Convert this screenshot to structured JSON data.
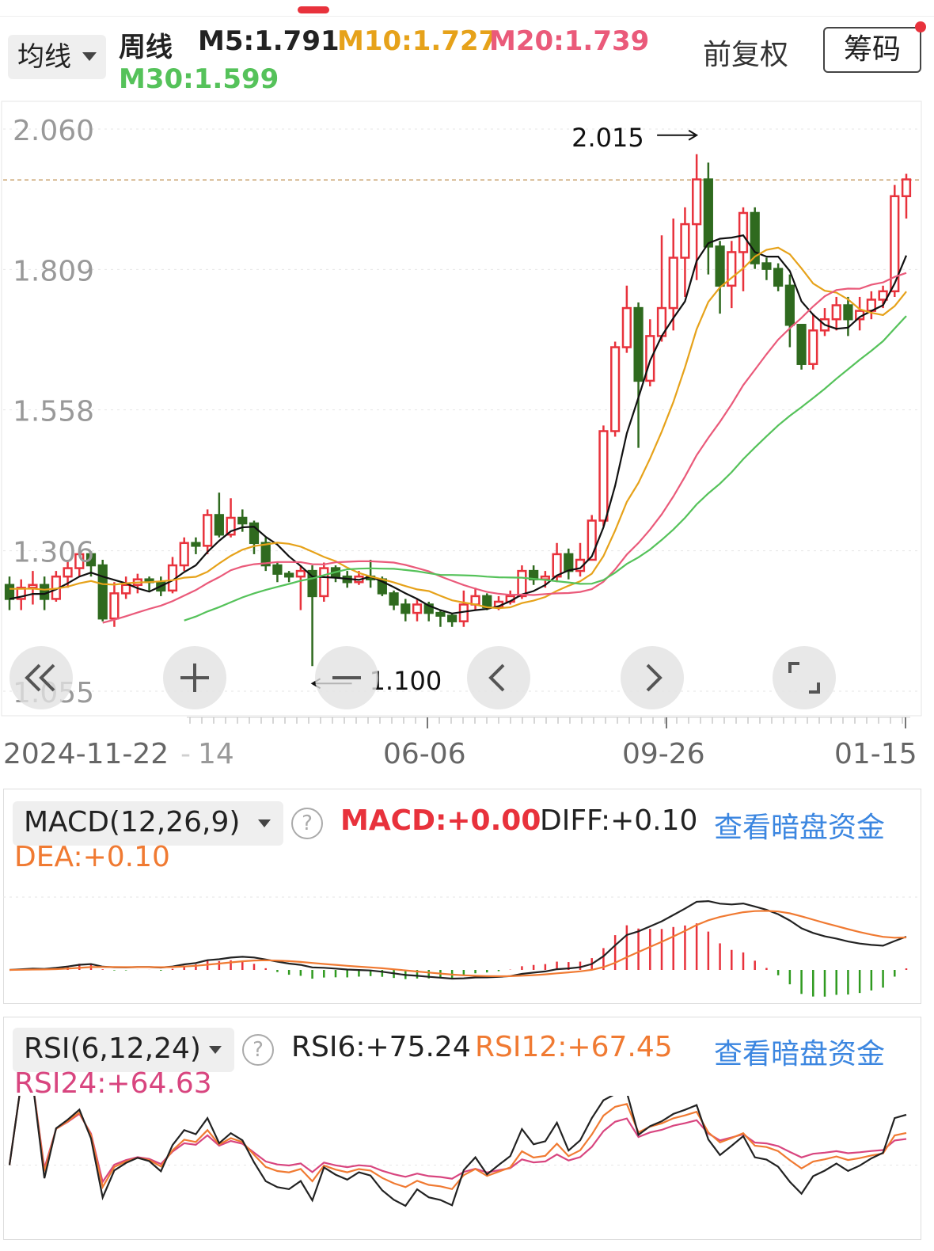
{
  "header": {
    "ma_select_label": "均线",
    "period": "周线",
    "ma": [
      {
        "label": "M5:1.791",
        "color": "#222222"
      },
      {
        "label": "M10:1.727",
        "color": "#e6a21a"
      },
      {
        "label": "M20:1.739",
        "color": "#ea5a7a"
      },
      {
        "label": "M30:1.599",
        "color": "#55c25a"
      }
    ],
    "adjust_label": "前复权",
    "chip_label": "筹码"
  },
  "main_chart": {
    "y_ticks": [
      "2.060",
      "1.809",
      "1.558",
      "1.306",
      "1.055"
    ],
    "x_ticks": [
      "2024-11-22",
      "14",
      "06-06",
      "09-26",
      "01-15"
    ],
    "high_annotation": "2.015",
    "low_annotation": "1.100",
    "current_price_line": 1.969,
    "colors": {
      "up": "#e8323c",
      "down": "#2f6a1f",
      "ma5": "#111111",
      "ma10": "#e6a21a",
      "ma20": "#ea5a7a",
      "ma30": "#55c25a"
    },
    "controls": [
      {
        "name": "scroll-start-button",
        "icon": "double-chevron-left-icon"
      },
      {
        "name": "zoom-in-button",
        "icon": "plus-icon"
      },
      {
        "name": "zoom-out-button",
        "icon": "minus-icon"
      },
      {
        "name": "previous-button",
        "icon": "chevron-left-icon"
      },
      {
        "name": "next-button",
        "icon": "chevron-right-icon"
      },
      {
        "name": "fullscreen-button",
        "icon": "fullscreen-icon"
      }
    ]
  },
  "macd_panel": {
    "select_label": "MACD(12,26,9)",
    "macd": "MACD:+0.00",
    "diff": "DIFF:+0.10",
    "dea": "DEA:+0.10",
    "link": "查看暗盘资金"
  },
  "rsi_panel": {
    "select_label": "RSI(6,12,24)",
    "rsi6": "RSI6:+75.24",
    "rsi12": "RSI12:+67.45",
    "rsi24": "RSI24:+64.63",
    "link": "查看暗盘资金"
  },
  "chart_data": {
    "type": "candlestick",
    "period": "weekly",
    "ylim": [
      1.055,
      2.06
    ],
    "candles": [
      [
        1.245,
        1.22,
        1.26,
        1.2
      ],
      [
        1.22,
        1.24,
        1.255,
        1.2
      ],
      [
        1.24,
        1.245,
        1.27,
        1.21
      ],
      [
        1.245,
        1.22,
        1.26,
        1.2
      ],
      [
        1.22,
        1.26,
        1.27,
        1.215
      ],
      [
        1.26,
        1.275,
        1.29,
        1.24
      ],
      [
        1.275,
        1.3,
        1.31,
        1.26
      ],
      [
        1.3,
        1.28,
        1.305,
        1.26
      ],
      [
        1.28,
        1.185,
        1.29,
        1.18
      ],
      [
        1.185,
        1.23,
        1.25,
        1.17
      ],
      [
        1.23,
        1.245,
        1.26,
        1.22
      ],
      [
        1.245,
        1.255,
        1.265,
        1.23
      ],
      [
        1.255,
        1.25,
        1.26,
        1.235
      ],
      [
        1.25,
        1.235,
        1.26,
        1.225
      ],
      [
        1.235,
        1.28,
        1.295,
        1.23
      ],
      [
        1.28,
        1.32,
        1.33,
        1.27
      ],
      [
        1.32,
        1.315,
        1.33,
        1.3
      ],
      [
        1.315,
        1.37,
        1.38,
        1.3
      ],
      [
        1.37,
        1.335,
        1.41,
        1.33
      ],
      [
        1.335,
        1.365,
        1.4,
        1.33
      ],
      [
        1.365,
        1.355,
        1.38,
        1.34
      ],
      [
        1.355,
        1.32,
        1.36,
        1.3
      ],
      [
        1.32,
        1.28,
        1.33,
        1.27
      ],
      [
        1.28,
        1.265,
        1.285,
        1.25
      ],
      [
        1.265,
        1.26,
        1.27,
        1.25
      ],
      [
        1.26,
        1.27,
        1.28,
        1.2
      ],
      [
        1.27,
        1.225,
        1.28,
        1.1
      ],
      [
        1.225,
        1.275,
        1.285,
        1.215
      ],
      [
        1.275,
        1.26,
        1.28,
        1.25
      ],
      [
        1.26,
        1.25,
        1.27,
        1.24
      ],
      [
        1.25,
        1.26,
        1.27,
        1.245
      ],
      [
        1.26,
        1.255,
        1.29,
        1.24
      ],
      [
        1.255,
        1.23,
        1.26,
        1.225
      ],
      [
        1.23,
        1.21,
        1.235,
        1.2
      ],
      [
        1.21,
        1.195,
        1.22,
        1.18
      ],
      [
        1.195,
        1.21,
        1.22,
        1.18
      ],
      [
        1.21,
        1.195,
        1.215,
        1.18
      ],
      [
        1.195,
        1.19,
        1.2,
        1.17
      ],
      [
        1.19,
        1.18,
        1.195,
        1.17
      ],
      [
        1.18,
        1.21,
        1.235,
        1.17
      ],
      [
        1.21,
        1.225,
        1.24,
        1.2
      ],
      [
        1.225,
        1.205,
        1.23,
        1.2
      ],
      [
        1.205,
        1.215,
        1.225,
        1.2
      ],
      [
        1.215,
        1.225,
        1.235,
        1.21
      ],
      [
        1.225,
        1.27,
        1.28,
        1.22
      ],
      [
        1.27,
        1.255,
        1.28,
        1.245
      ],
      [
        1.255,
        1.26,
        1.27,
        1.24
      ],
      [
        1.26,
        1.3,
        1.32,
        1.25
      ],
      [
        1.3,
        1.27,
        1.31,
        1.255
      ],
      [
        1.27,
        1.29,
        1.32,
        1.26
      ],
      [
        1.29,
        1.36,
        1.37,
        1.29
      ],
      [
        1.36,
        1.52,
        1.53,
        1.35
      ],
      [
        1.52,
        1.67,
        1.68,
        1.51
      ],
      [
        1.67,
        1.74,
        1.78,
        1.66
      ],
      [
        1.74,
        1.61,
        1.75,
        1.49
      ],
      [
        1.61,
        1.69,
        1.72,
        1.6
      ],
      [
        1.69,
        1.74,
        1.87,
        1.68
      ],
      [
        1.74,
        1.83,
        1.9,
        1.7
      ],
      [
        1.83,
        1.89,
        1.92,
        1.76
      ],
      [
        1.89,
        1.97,
        2.015,
        1.79
      ],
      [
        1.97,
        1.85,
        2.0,
        1.8
      ],
      [
        1.85,
        1.78,
        1.86,
        1.73
      ],
      [
        1.78,
        1.84,
        1.86,
        1.74
      ],
      [
        1.84,
        1.91,
        1.92,
        1.77
      ],
      [
        1.91,
        1.82,
        1.92,
        1.81
      ],
      [
        1.82,
        1.81,
        1.83,
        1.79
      ],
      [
        1.81,
        1.78,
        1.82,
        1.77
      ],
      [
        1.78,
        1.71,
        1.8,
        1.67
      ],
      [
        1.71,
        1.64,
        1.71,
        1.63
      ],
      [
        1.64,
        1.7,
        1.73,
        1.63
      ],
      [
        1.7,
        1.72,
        1.74,
        1.69
      ],
      [
        1.72,
        1.745,
        1.76,
        1.7
      ],
      [
        1.745,
        1.72,
        1.76,
        1.69
      ],
      [
        1.72,
        1.735,
        1.76,
        1.7
      ],
      [
        1.735,
        1.755,
        1.77,
        1.72
      ],
      [
        1.755,
        1.77,
        1.78,
        1.74
      ],
      [
        1.77,
        1.94,
        1.96,
        1.76
      ],
      [
        1.94,
        1.97,
        1.98,
        1.9
      ]
    ],
    "ma5_endpoints": [
      1.22,
      1.791
    ],
    "ma10_endpoints": [
      1.24,
      1.727
    ],
    "ma20_endpoints": [
      1.12,
      1.739
    ],
    "ma30_endpoints": [
      1.1,
      1.599
    ]
  }
}
